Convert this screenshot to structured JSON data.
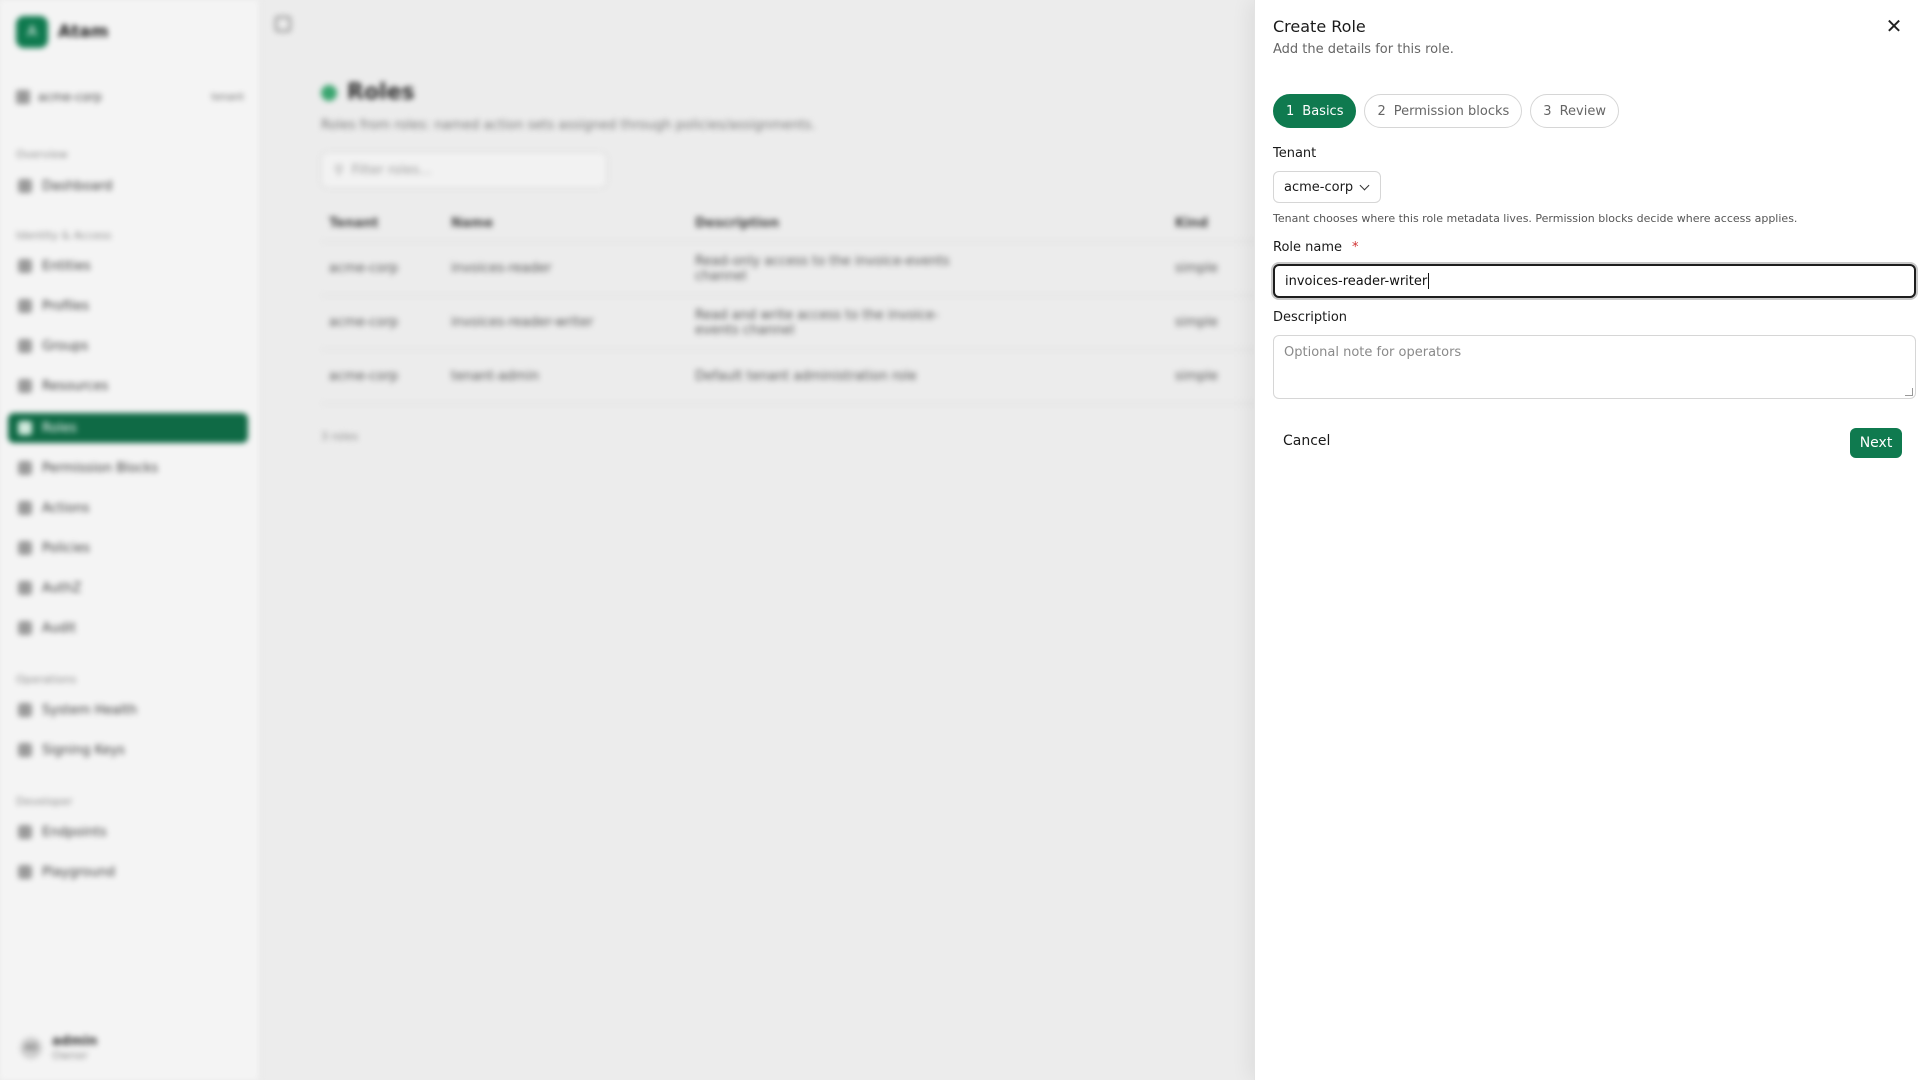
{
  "app": {
    "brand_initial": "A",
    "brand_name": "Atam",
    "tenant_switch": {
      "label": "acme-corp",
      "chip": "tenant"
    },
    "sidebar": {
      "sections": [
        {
          "title": "Overview",
          "items": [
            "Dashboard"
          ]
        },
        {
          "title": "Identity & Access",
          "items": [
            "Entities",
            "Profiles",
            "Groups",
            "Resources",
            "Roles",
            "Permission Blocks",
            "Actions",
            "Policies",
            "AuthZ",
            "Audit"
          ]
        },
        {
          "title": "Operations",
          "items": [
            "System Health",
            "Signing Keys"
          ]
        },
        {
          "title": "Developer",
          "items": [
            "Endpoints",
            "Playground"
          ]
        }
      ],
      "active": "Roles"
    },
    "user": {
      "initials": "AD",
      "name": "admin",
      "role": "Owner"
    }
  },
  "page": {
    "title": "Roles",
    "subtitle": "Roles from roles: named action sets assigned through policies/assignments.",
    "filter_placeholder": "Filter roles...",
    "columns": [
      "Tenant",
      "Name",
      "Description",
      "Kind"
    ],
    "rows": [
      {
        "tenant": "acme-corp",
        "name": "invoices-reader",
        "description": "Read-only access to the invoice-events channel",
        "kind": "simple"
      },
      {
        "tenant": "acme-corp",
        "name": "invoices-reader-writer",
        "description": "Read and write access to the invoice-events channel",
        "kind": "simple"
      },
      {
        "tenant": "acme-corp",
        "name": "tenant-admin",
        "description": "Default tenant administration role",
        "kind": "simple"
      }
    ],
    "count_label": "3 roles"
  },
  "drawer": {
    "title": "Create Role",
    "subtitle": "Add the details for this role.",
    "close_icon": "close-icon",
    "steps": [
      {
        "num": "1",
        "label": "Basics",
        "active": true
      },
      {
        "num": "2",
        "label": "Permission blocks",
        "active": false
      },
      {
        "num": "3",
        "label": "Review",
        "active": false
      }
    ],
    "tenant_label": "Tenant",
    "tenant_value": "acme-corp",
    "tenant_hint": "Tenant chooses where this role metadata lives. Permission blocks decide where access applies.",
    "role_name_label": "Role name",
    "required_mark": "*",
    "role_name_value": "invoices-reader-writer",
    "description_label": "Description",
    "description_placeholder": "Optional note for operators",
    "cancel_label": "Cancel",
    "next_label": "Next",
    "accent": "#0f7a4f"
  }
}
